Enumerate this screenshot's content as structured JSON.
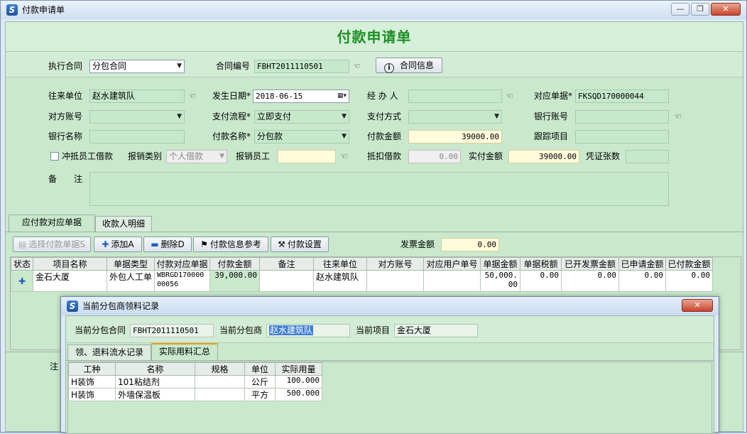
{
  "window": {
    "title": "付款申请单",
    "minimize_glyph": "—",
    "restore_glyph": "❐",
    "close_glyph": "✕"
  },
  "page_title": "付款申请单",
  "contract_row": {
    "exec_contract_label": "执行合同",
    "exec_contract_value": "分包合同",
    "contract_no_label": "合同编号",
    "contract_no_value": "FBHT2011110501",
    "contract_info_button": "合同信息"
  },
  "form": {
    "counterparty_label": "往来单位",
    "counterparty_value": "赵水建筑队",
    "date_label": "发生日期*",
    "date_value": "2018-06-15",
    "handler_label": "经 办 人",
    "handler_value": "",
    "ref_doc_label": "对应单据*",
    "ref_doc_value": "FKSQD170000044",
    "peer_account_label": "对方账号",
    "peer_account_value": "",
    "pay_flow_label": "支付流程*",
    "pay_flow_value": "立即支付",
    "pay_method_label": "支付方式",
    "pay_method_value": "",
    "bank_account_label": "银行账号",
    "bank_account_value": "",
    "bank_name_label": "银行名称",
    "bank_name_value": "",
    "pay_name_label": "付款名称*",
    "pay_name_value": "分包款",
    "pay_amount_label": "付款金额",
    "pay_amount_value": "39000.00",
    "track_item_label": "跟踪项目",
    "track_item_value": "",
    "offset_loan_label": "冲抵员工借款",
    "reimb_type_label": "报销类别",
    "reimb_type_value": "个人借款",
    "reimb_staff_label": "报销员工",
    "reimb_staff_value": "",
    "deduct_loan_label": "抵扣借款",
    "deduct_loan_value": "0.00",
    "actual_pay_label": "实付金额",
    "actual_pay_value": "39000.00",
    "voucher_count_label": "凭证张数",
    "voucher_count_value": "",
    "remark_label": "备　注",
    "remark_value": ""
  },
  "tabs": [
    {
      "label": "应付款对应单据"
    },
    {
      "label": "收款人明细"
    }
  ],
  "toolbar": {
    "select_docs": "选择付款单据S",
    "add": "添加A",
    "delete": "删除D",
    "pay_ref": "付款信息参考",
    "pay_settings": "付款设置",
    "invoice_amount_label": "发票金额",
    "invoice_amount_value": "0.00"
  },
  "grid": {
    "columns": [
      "状态",
      "项目名称",
      "单据类型",
      "付款对应单据",
      "付款金额",
      "备注",
      "往来单位",
      "对方账号",
      "对应用户单号",
      "单据金额",
      "单据税额",
      "已开发票金额",
      "已申请金额",
      "已付款金额"
    ],
    "rows": [
      {
        "status_glyph": "✚",
        "project": "金石大厦",
        "doc_type": "外包人工单",
        "ref_doc": "WBRGD17000000056",
        "pay_amount": "39,000.00",
        "remark": "",
        "counterparty": "赵水建筑队",
        "peer_account": "",
        "user_no": "",
        "doc_amount": "50,000.00",
        "doc_tax": "0.00",
        "invoiced": "0.00",
        "applied": "0.00",
        "paid": "0.00"
      }
    ]
  },
  "note_label": "注",
  "dialog": {
    "title": "当前分包商领料记录",
    "close_glyph": "✕",
    "cur_contract_label": "当前分包合同",
    "cur_contract_value": "FBHT2011110501",
    "cur_sub_label": "当前分包商",
    "cur_sub_value": "赵水建筑队",
    "cur_project_label": "当前项目",
    "cur_project_value": "金石大厦",
    "tabs": [
      {
        "label": "领、退料流水记录"
      },
      {
        "label": "实际用料汇总"
      }
    ],
    "columns": [
      "工种",
      "名称",
      "规格",
      "单位",
      "实际用量"
    ],
    "rows": [
      {
        "trade": "H装饰",
        "name": "101粘结剂",
        "spec": "",
        "unit": "公斤",
        "qty": "100.000"
      },
      {
        "trade": "H装饰",
        "name": "外墙保温板",
        "spec": "",
        "unit": "平方",
        "qty": "500.000"
      }
    ]
  },
  "colors": {
    "title_green": "#1e8f25",
    "form_bg": "#c9e8cc",
    "field_green": "#c6e9cb",
    "field_yellow": "#fffbdc"
  }
}
